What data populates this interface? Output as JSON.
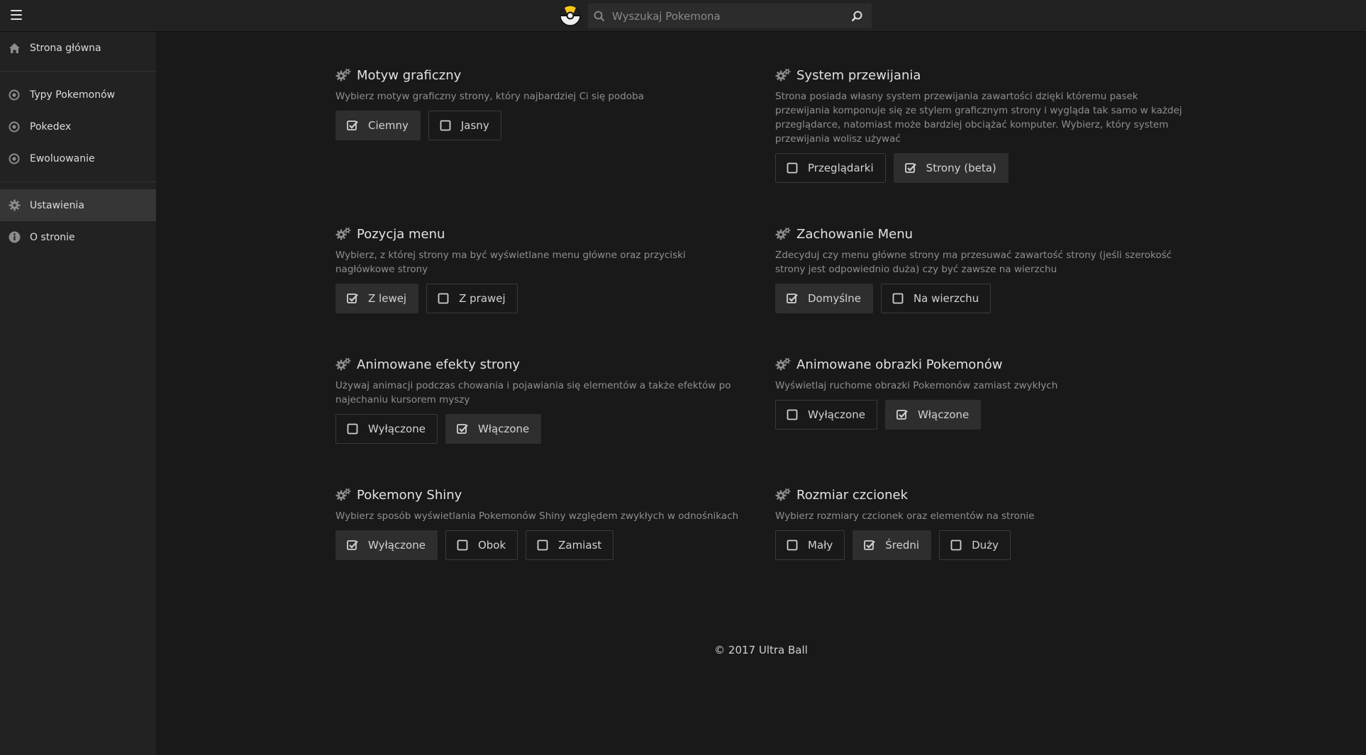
{
  "header": {
    "menu_icon": "hamburger-icon",
    "logo": "ultra-ball-logo",
    "search_placeholder": "Wyszukaj Pokemona"
  },
  "sidebar": {
    "items": [
      {
        "label": "Strona główna",
        "icon": "home-icon"
      },
      {
        "label": "Typy Pokemonów",
        "icon": "target-icon"
      },
      {
        "label": "Pokedex",
        "icon": "target-icon"
      },
      {
        "label": "Ewoluowanie",
        "icon": "target-icon"
      },
      {
        "label": "Ustawienia",
        "icon": "gear-icon",
        "active": true
      },
      {
        "label": "O stronie",
        "icon": "info-icon"
      }
    ]
  },
  "settings": [
    {
      "title": "Motyw graficzny",
      "desc": "Wybierz motyw graficzny strony, który najbardziej Ci się podoba",
      "options": [
        {
          "label": "Ciemny",
          "checked": true
        },
        {
          "label": "Jasny",
          "checked": false
        }
      ]
    },
    {
      "title": "System przewijania",
      "desc": "Strona posiada własny system przewijania zawartości dzięki któremu pasek przewijania komponuje się ze stylem graficznym strony i wygląda tak samo w każdej przeglądarce, natomiast może bardziej obciążać komputer. Wybierz, który system przewijania wolisz używać",
      "options": [
        {
          "label": "Przeglądarki",
          "checked": false
        },
        {
          "label": "Strony (beta)",
          "checked": true
        }
      ]
    },
    {
      "title": "Pozycja menu",
      "desc": "Wybierz, z której strony ma być wyświetlane menu główne oraz przyciski nagłówkowe strony",
      "options": [
        {
          "label": "Z lewej",
          "checked": true
        },
        {
          "label": "Z prawej",
          "checked": false
        }
      ]
    },
    {
      "title": "Zachowanie Menu",
      "desc": "Zdecyduj czy menu główne strony ma przesuwać zawartość strony (jeśli szerokość strony jest odpowiednio duża) czy być zawsze na wierzchu",
      "options": [
        {
          "label": "Domyślne",
          "checked": true
        },
        {
          "label": "Na wierzchu",
          "checked": false
        }
      ]
    },
    {
      "title": "Animowane efekty strony",
      "desc": "Używaj animacji podczas chowania i pojawiania się elementów a także efektów po najechaniu kursorem myszy",
      "options": [
        {
          "label": "Wyłączone",
          "checked": false
        },
        {
          "label": "Włączone",
          "checked": true
        }
      ]
    },
    {
      "title": "Animowane obrazki Pokemonów",
      "desc": "Wyświetlaj ruchome obrazki Pokemonów zamiast zwykłych",
      "options": [
        {
          "label": "Wyłączone",
          "checked": false
        },
        {
          "label": "Włączone",
          "checked": true
        }
      ]
    },
    {
      "title": "Pokemony Shiny",
      "desc": "Wybierz sposób wyświetlania Pokemonów Shiny względem zwykłych w odnośnikach",
      "options": [
        {
          "label": "Wyłączone",
          "checked": true
        },
        {
          "label": "Obok",
          "checked": false
        },
        {
          "label": "Zamiast",
          "checked": false
        }
      ]
    },
    {
      "title": "Rozmiar czcionek",
      "desc": "Wybierz rozmiary czcionek oraz elementów na stronie",
      "options": [
        {
          "label": "Mały",
          "checked": false
        },
        {
          "label": "Średni",
          "checked": true
        },
        {
          "label": "Duży",
          "checked": false
        }
      ]
    }
  ],
  "footer": {
    "text": "© 2017 Ultra Ball"
  },
  "colors": {
    "background": "#191919",
    "sidebar": "#222222",
    "active": "#363636",
    "accent_logo": "#f5c518"
  }
}
